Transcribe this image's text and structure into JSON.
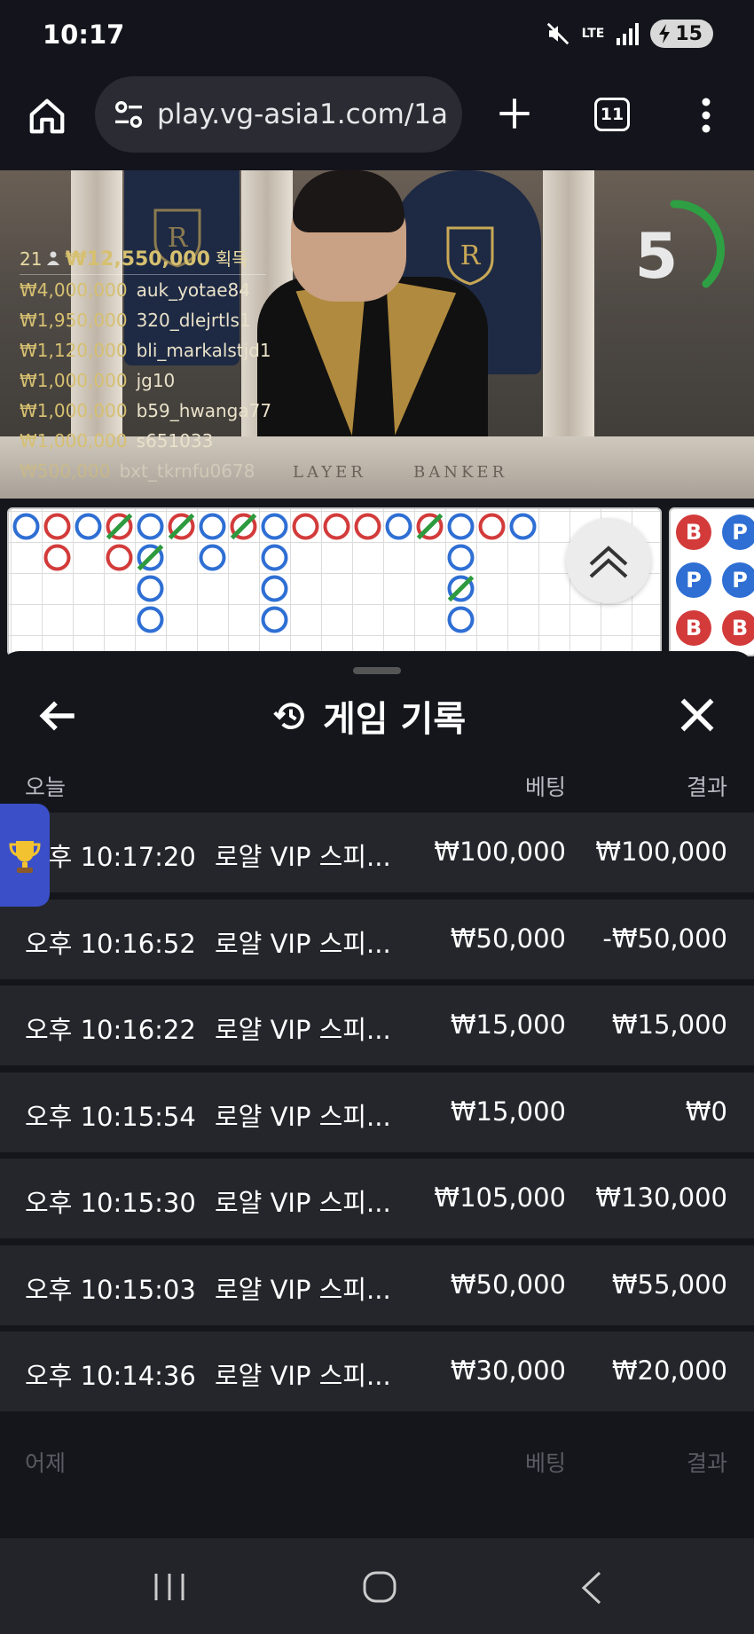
{
  "status_bar": {
    "time": "10:17",
    "network": "LTE",
    "battery": "15"
  },
  "browser": {
    "url": "play.vg-asia1.com/1a",
    "tab_count": "11"
  },
  "stream": {
    "winners_count": "21",
    "winners_total": "₩12,550,000",
    "winners_suffix": "획득",
    "winners": [
      {
        "amount": "₩4,000,000",
        "name": "auk_yotae84"
      },
      {
        "amount": "₩1,950,000",
        "name": "320_dlejrtls1"
      },
      {
        "amount": "₩1,120,000",
        "name": "bli_markalstjd1"
      },
      {
        "amount": "₩1,000,000",
        "name": "jg10"
      },
      {
        "amount": "₩1,000,000",
        "name": "b59_hwanga77"
      },
      {
        "amount": "₩1,000,000",
        "name": "s651033"
      },
      {
        "amount": "₩500,000",
        "name": "bxt_tkrnfu0678"
      }
    ],
    "countdown": "5",
    "felt_left": "LAYER",
    "felt_right": "BANKER"
  },
  "bead_road": [
    "B",
    "P",
    "B",
    "P",
    "P",
    "B"
  ],
  "sheet": {
    "title": "게임 기록",
    "today_header": {
      "label": "오늘",
      "bet": "베팅",
      "result": "결과"
    },
    "yesterday_header": {
      "label": "어제",
      "bet": "베팅",
      "result": "결과"
    },
    "rows": [
      {
        "time": "오후 10:17:20",
        "game": "로얄 VIP 스피...",
        "bet": "₩100,000",
        "result": "₩100,000"
      },
      {
        "time": "오후 10:16:52",
        "game": "로얄 VIP 스피...",
        "bet": "₩50,000",
        "result": "-₩50,000"
      },
      {
        "time": "오후 10:16:22",
        "game": "로얄 VIP 스피...",
        "bet": "₩15,000",
        "result": "₩15,000"
      },
      {
        "time": "오후 10:15:54",
        "game": "로얄 VIP 스피...",
        "bet": "₩15,000",
        "result": "₩0"
      },
      {
        "time": "오후 10:15:30",
        "game": "로얄 VIP 스피...",
        "bet": "₩105,000",
        "result": "₩130,000"
      },
      {
        "time": "오후 10:15:03",
        "game": "로얄 VIP 스피...",
        "bet": "₩50,000",
        "result": "₩55,000"
      },
      {
        "time": "오후 10:14:36",
        "game": "로얄 VIP 스피...",
        "bet": "₩30,000",
        "result": "₩20,000"
      }
    ]
  },
  "colors": {
    "banker": "#d33b3b",
    "player": "#2f6fd4",
    "tie": "#2e9a3e",
    "gold": "#d6c070",
    "timer": "#2ea043"
  },
  "icons": {
    "home": "home-icon",
    "site_settings": "tune-icon",
    "new_tab": "plus-icon",
    "menu": "more-vert-icon",
    "history": "history-icon",
    "back": "arrow-left-icon",
    "close": "close-icon",
    "trophy": "trophy-icon"
  }
}
